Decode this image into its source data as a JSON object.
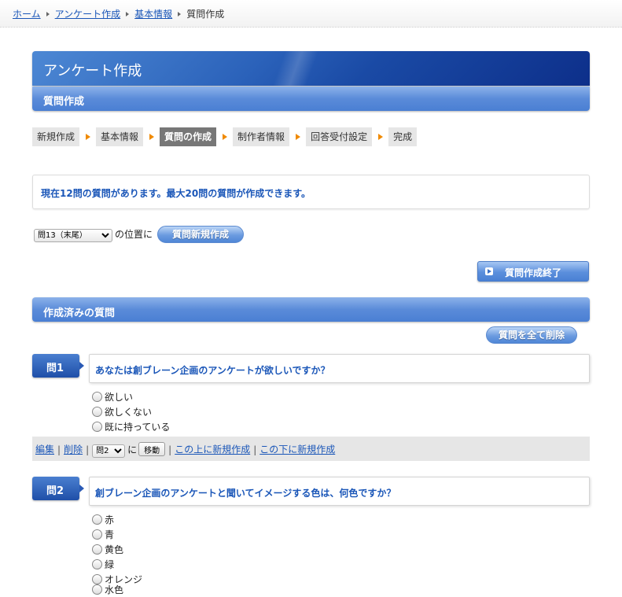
{
  "breadcrumb": {
    "items": [
      "ホーム",
      "アンケート作成",
      "基本情報"
    ],
    "current": "質問作成"
  },
  "header": {
    "title": "アンケート作成",
    "subtitle": "質問作成"
  },
  "steps": [
    {
      "label": "新規作成",
      "active": false
    },
    {
      "label": "基本情報",
      "active": false
    },
    {
      "label": "質問の作成",
      "active": true
    },
    {
      "label": "制作者情報",
      "active": false
    },
    {
      "label": "回答受付設定",
      "active": false
    },
    {
      "label": "完成",
      "active": false
    }
  ],
  "notice": "現在12問の質問があります。最大20問の質問が作成できます。",
  "new_question": {
    "position_select": "問13（末尾）",
    "position_suffix": "の位置に",
    "button": "質問新規作成"
  },
  "finish_button": "質問作成終了",
  "created_section": {
    "title": "作成済みの質問",
    "delete_all_button": "質問を全て削除"
  },
  "questions": [
    {
      "badge": "問1",
      "text": "あなたは創ブレーン企画のアンケートが欲しいですか？",
      "options": [
        "欲しい",
        "欲しくない",
        "既に持っている"
      ]
    },
    {
      "badge": "問2",
      "text": "創ブレーン企画のアンケートと聞いてイメージする色は、何色ですか？",
      "options": [
        "赤",
        "青",
        "黄色",
        "緑",
        "オレンジ",
        "水色"
      ]
    }
  ],
  "actions": {
    "edit": "編集",
    "delete": "削除",
    "move_select": "問2",
    "move_prefix": "に",
    "move_button": "移動",
    "create_above": "この上に新規作成",
    "create_below": "この下に新規作成"
  },
  "colors": {
    "accent": "#1a56b8",
    "header": "#1a4aa5",
    "step_arrow": "#f08a00"
  }
}
